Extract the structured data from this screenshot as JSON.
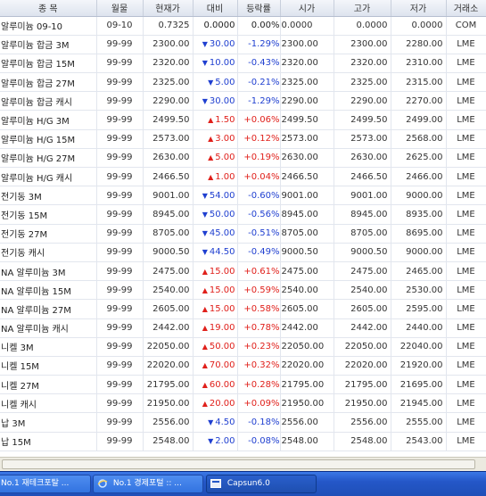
{
  "columns": [
    "종 목",
    "월물",
    "현재가",
    "대비",
    "등락률",
    "시가",
    "고가",
    "저가",
    "거래소"
  ],
  "rows": [
    {
      "name": "알루미늄 09-10",
      "month": "09-10",
      "price": "0.7325",
      "dir": "flat",
      "change": "0.0000",
      "pct": "0.00%",
      "open": "0.0000",
      "high": "0.0000",
      "low": "0.0000",
      "exch": "COM"
    },
    {
      "name": "알루미늄 합금 3M",
      "month": "99-99",
      "price": "2300.00",
      "dir": "down",
      "change": "30.00",
      "pct": "-1.29%",
      "open": "2300.00",
      "high": "2300.00",
      "low": "2280.00",
      "exch": "LME"
    },
    {
      "name": "알루미늄 합금 15M",
      "month": "99-99",
      "price": "2320.00",
      "dir": "down",
      "change": "10.00",
      "pct": "-0.43%",
      "open": "2320.00",
      "high": "2320.00",
      "low": "2310.00",
      "exch": "LME"
    },
    {
      "name": "알루미늄 합금 27M",
      "month": "99-99",
      "price": "2325.00",
      "dir": "down",
      "change": "5.00",
      "pct": "-0.21%",
      "open": "2325.00",
      "high": "2325.00",
      "low": "2315.00",
      "exch": "LME"
    },
    {
      "name": "알루미늄 합금 캐시",
      "month": "99-99",
      "price": "2290.00",
      "dir": "down",
      "change": "30.00",
      "pct": "-1.29%",
      "open": "2290.00",
      "high": "2290.00",
      "low": "2270.00",
      "exch": "LME"
    },
    {
      "name": "알루미늄 H/G 3M",
      "month": "99-99",
      "price": "2499.50",
      "dir": "up",
      "change": "1.50",
      "pct": "+0.06%",
      "open": "2499.50",
      "high": "2499.50",
      "low": "2499.00",
      "exch": "LME"
    },
    {
      "name": "알루미늄 H/G 15M",
      "month": "99-99",
      "price": "2573.00",
      "dir": "up",
      "change": "3.00",
      "pct": "+0.12%",
      "open": "2573.00",
      "high": "2573.00",
      "low": "2568.00",
      "exch": "LME"
    },
    {
      "name": "알루미늄 H/G 27M",
      "month": "99-99",
      "price": "2630.00",
      "dir": "up",
      "change": "5.00",
      "pct": "+0.19%",
      "open": "2630.00",
      "high": "2630.00",
      "low": "2625.00",
      "exch": "LME"
    },
    {
      "name": "알루미늄 H/G 캐시",
      "month": "99-99",
      "price": "2466.50",
      "dir": "up",
      "change": "1.00",
      "pct": "+0.04%",
      "open": "2466.50",
      "high": "2466.50",
      "low": "2466.00",
      "exch": "LME"
    },
    {
      "name": "전기동 3M",
      "month": "99-99",
      "price": "9001.00",
      "dir": "down",
      "change": "54.00",
      "pct": "-0.60%",
      "open": "9001.00",
      "high": "9001.00",
      "low": "9000.00",
      "exch": "LME"
    },
    {
      "name": "전기동 15M",
      "month": "99-99",
      "price": "8945.00",
      "dir": "down",
      "change": "50.00",
      "pct": "-0.56%",
      "open": "8945.00",
      "high": "8945.00",
      "low": "8935.00",
      "exch": "LME"
    },
    {
      "name": "전기동 27M",
      "month": "99-99",
      "price": "8705.00",
      "dir": "down",
      "change": "45.00",
      "pct": "-0.51%",
      "open": "8705.00",
      "high": "8705.00",
      "low": "8695.00",
      "exch": "LME"
    },
    {
      "name": "전기동 캐시",
      "month": "99-99",
      "price": "9000.50",
      "dir": "down",
      "change": "44.50",
      "pct": "-0.49%",
      "open": "9000.50",
      "high": "9000.50",
      "low": "9000.00",
      "exch": "LME"
    },
    {
      "name": "NA 알루미늄 3M",
      "month": "99-99",
      "price": "2475.00",
      "dir": "up",
      "change": "15.00",
      "pct": "+0.61%",
      "open": "2475.00",
      "high": "2475.00",
      "low": "2465.00",
      "exch": "LME"
    },
    {
      "name": "NA 알루미늄 15M",
      "month": "99-99",
      "price": "2540.00",
      "dir": "up",
      "change": "15.00",
      "pct": "+0.59%",
      "open": "2540.00",
      "high": "2540.00",
      "low": "2530.00",
      "exch": "LME"
    },
    {
      "name": "NA 알루미늄 27M",
      "month": "99-99",
      "price": "2605.00",
      "dir": "up",
      "change": "15.00",
      "pct": "+0.58%",
      "open": "2605.00",
      "high": "2605.00",
      "low": "2595.00",
      "exch": "LME"
    },
    {
      "name": "NA 알루미늄 캐시",
      "month": "99-99",
      "price": "2442.00",
      "dir": "up",
      "change": "19.00",
      "pct": "+0.78%",
      "open": "2442.00",
      "high": "2442.00",
      "low": "2440.00",
      "exch": "LME"
    },
    {
      "name": "니켈 3M",
      "month": "99-99",
      "price": "22050.00",
      "dir": "up",
      "change": "50.00",
      "pct": "+0.23%",
      "open": "22050.00",
      "high": "22050.00",
      "low": "22040.00",
      "exch": "LME"
    },
    {
      "name": "니켈 15M",
      "month": "99-99",
      "price": "22020.00",
      "dir": "up",
      "change": "70.00",
      "pct": "+0.32%",
      "open": "22020.00",
      "high": "22020.00",
      "low": "21920.00",
      "exch": "LME"
    },
    {
      "name": "니켈 27M",
      "month": "99-99",
      "price": "21795.00",
      "dir": "up",
      "change": "60.00",
      "pct": "+0.28%",
      "open": "21795.00",
      "high": "21795.00",
      "low": "21695.00",
      "exch": "LME"
    },
    {
      "name": "니켈 캐시",
      "month": "99-99",
      "price": "21950.00",
      "dir": "up",
      "change": "20.00",
      "pct": "+0.09%",
      "open": "21950.00",
      "high": "21950.00",
      "low": "21945.00",
      "exch": "LME"
    },
    {
      "name": "납 3M",
      "month": "99-99",
      "price": "2556.00",
      "dir": "down",
      "change": "4.50",
      "pct": "-0.18%",
      "open": "2556.00",
      "high": "2556.00",
      "low": "2555.00",
      "exch": "LME"
    },
    {
      "name": "납 15M",
      "month": "99-99",
      "price": "2548.00",
      "dir": "down",
      "change": "2.00",
      "pct": "-0.08%",
      "open": "2548.00",
      "high": "2548.00",
      "low": "2543.00",
      "exch": "LME"
    }
  ],
  "arrows": {
    "up": "▲",
    "down": "▼",
    "flat": ""
  },
  "colors": {
    "up": "#e0201b",
    "down": "#1f3fd0",
    "flat": "#222222",
    "header_bg": "#dde3ee",
    "taskbar": "#2457c8"
  },
  "taskbar": {
    "items": [
      {
        "label": "No.1 재테크포탈 ...",
        "icon": "app-icon"
      },
      {
        "label": "No.1 경제포털 :: ...",
        "icon": "ie-icon"
      },
      {
        "label": "Capsun6.0",
        "icon": "app-icon"
      }
    ]
  }
}
